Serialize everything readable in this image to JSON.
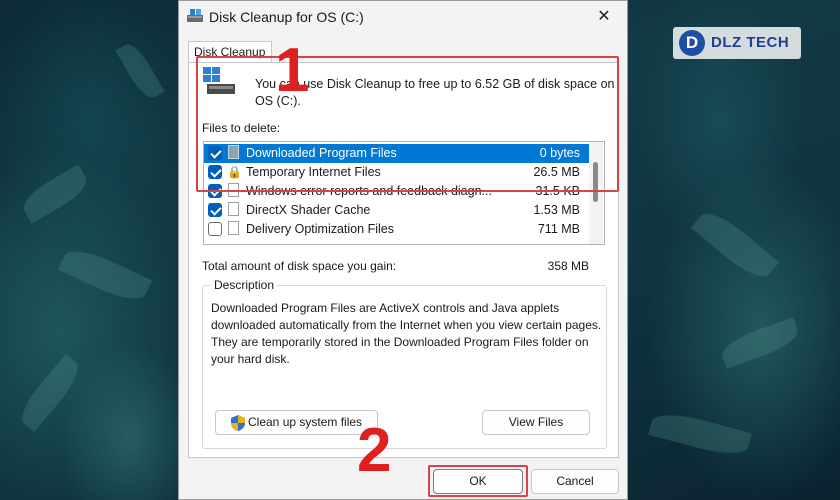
{
  "window": {
    "title": "Disk Cleanup for OS (C:)",
    "close": "✕"
  },
  "tab": {
    "label": "Disk Cleanup"
  },
  "intro": {
    "text": "You can use Disk Cleanup to free up to 6.52 GB of disk space on OS (C:)."
  },
  "files": {
    "label": "Files to delete:",
    "items": [
      {
        "name": "Downloaded Program Files",
        "size": "0 bytes",
        "checked": true,
        "selected": true
      },
      {
        "name": "Temporary Internet Files",
        "size": "26.5 MB",
        "checked": true,
        "selected": false
      },
      {
        "name": "Windows error reports and feedback diagn...",
        "size": "31.5 KB",
        "checked": true,
        "selected": false
      },
      {
        "name": "DirectX Shader Cache",
        "size": "1.53 MB",
        "checked": true,
        "selected": false
      },
      {
        "name": "Delivery Optimization Files",
        "size": "711 MB",
        "checked": false,
        "selected": false
      }
    ]
  },
  "total": {
    "label": "Total amount of disk space you gain:",
    "value": "358 MB"
  },
  "description": {
    "title": "Description",
    "text": "Downloaded Program Files are ActiveX controls and Java applets downloaded automatically from the Internet when you view certain pages. They are temporarily stored in the Downloaded Program Files folder on your hard disk."
  },
  "buttons": {
    "cleanup": "Clean up system files",
    "view": "View Files",
    "ok": "OK",
    "cancel": "Cancel"
  },
  "annotations": {
    "step1": "1",
    "step2": "2"
  },
  "logo": {
    "mark": "D",
    "text": "DLZ TECH"
  },
  "colors": {
    "annotation": "#e02020",
    "selection": "#0078d4",
    "checkbox": "#005fb8"
  }
}
